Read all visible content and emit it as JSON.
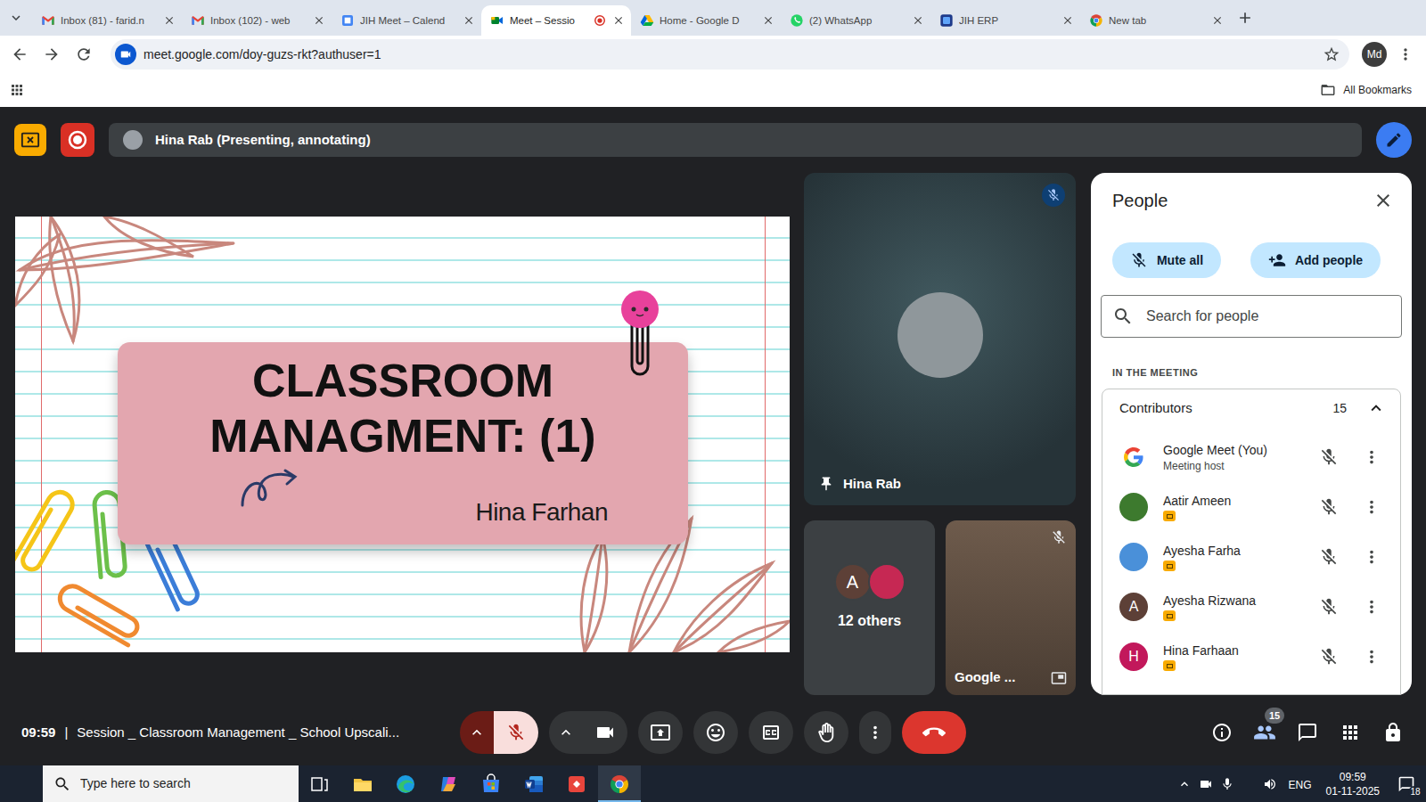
{
  "browser": {
    "tabs": [
      {
        "label": "Inbox (81) - farid.n",
        "kind": "gmail",
        "selected": false,
        "recording": false
      },
      {
        "label": "Inbox (102) - web",
        "kind": "gmail",
        "selected": false,
        "recording": false
      },
      {
        "label": "JIH Meet – Calend",
        "kind": "calendar",
        "selected": false,
        "recording": false
      },
      {
        "label": "Meet – Sessio",
        "kind": "meet",
        "selected": true,
        "recording": true
      },
      {
        "label": "Home - Google D",
        "kind": "drive",
        "selected": false,
        "recording": false
      },
      {
        "label": "(2) WhatsApp",
        "kind": "whatsapp",
        "selected": false,
        "recording": false
      },
      {
        "label": "JIH ERP",
        "kind": "erp",
        "selected": false,
        "recording": false
      },
      {
        "label": "New tab",
        "kind": "chrome",
        "selected": false,
        "recording": false
      }
    ],
    "url": "meet.google.com/doy-guzs-rkt?authuser=1",
    "bookmarked": false,
    "profile": "Md",
    "bookmarks_folder": "All Bookmarks"
  },
  "meet": {
    "presenting_banner": {
      "text": "Hina Rab (Presenting, annotating)",
      "recording": true
    },
    "slide": {
      "title_lines": [
        "CLASSROOM",
        "MANAGMENT: (1)"
      ],
      "author": "Hina Farhan"
    },
    "pinned_tile": {
      "name": "Hina Rab",
      "pinned": true,
      "muted": true
    },
    "others_tile": {
      "label": "12 others",
      "avatars": [
        {
          "kind": "letter",
          "letter": "A",
          "color": "#5d4037"
        },
        {
          "kind": "photo",
          "color": "#c62853"
        }
      ]
    },
    "self_tile": {
      "name": "Google ...",
      "muted": true
    },
    "people_panel": {
      "title": "People",
      "mute_all": "Mute all",
      "add_people": "Add people",
      "search_placeholder": "Search for people",
      "section": "IN THE MEETING",
      "group": {
        "label": "Contributors",
        "count": "15",
        "expanded": true
      },
      "people": [
        {
          "name": "Google Meet (You)",
          "role": "Meeting host",
          "avatar": {
            "kind": "logo"
          },
          "badge": false,
          "muted": true
        },
        {
          "name": "Aatir Ameen",
          "avatar": {
            "kind": "photo",
            "color": "#3d7a2e"
          },
          "badge": true,
          "muted": true
        },
        {
          "name": "Ayesha Farha",
          "avatar": {
            "kind": "photo",
            "color": "#4a90d9"
          },
          "badge": true,
          "muted": true
        },
        {
          "name": "Ayesha Rizwana",
          "avatar": {
            "kind": "letter",
            "letter": "A",
            "color": "#5d4037"
          },
          "badge": true,
          "muted": true
        },
        {
          "name": "Hina Farhaan",
          "avatar": {
            "kind": "letter",
            "letter": "H",
            "color": "#c2185b"
          },
          "badge": true,
          "muted": true
        }
      ]
    },
    "bottom_bar": {
      "time": "09:59",
      "separator": "|",
      "title": "Session _ Classroom Management _ School Upscali...",
      "mic_muted": true,
      "camera_on": true,
      "people_count": "15"
    }
  },
  "taskbar": {
    "search_placeholder": "Type here to search",
    "apps": [
      {
        "kind": "taskview",
        "active": false
      },
      {
        "kind": "explorer",
        "active": false
      },
      {
        "kind": "edge",
        "active": false
      },
      {
        "kind": "copilot",
        "active": false
      },
      {
        "kind": "store",
        "active": false
      },
      {
        "kind": "word",
        "active": false
      },
      {
        "kind": "app",
        "active": false
      },
      {
        "kind": "chrome",
        "active": true
      }
    ],
    "language": "ENG",
    "time": "09:59",
    "date": "01-11-2025",
    "notifications": "18"
  }
}
